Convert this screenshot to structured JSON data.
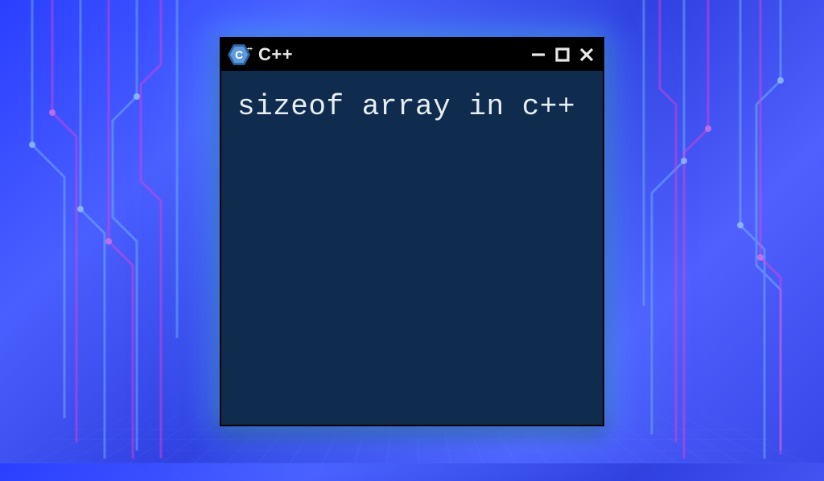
{
  "window": {
    "title": "C++",
    "logo_letter": "C",
    "logo_plus": "++"
  },
  "content": {
    "text": "sizeof array in c++"
  },
  "colors": {
    "window_bg": "#0f2b4d",
    "titlebar_bg": "#000000",
    "text": "#e6edf3",
    "accent_blue": "#5e9bdc"
  }
}
